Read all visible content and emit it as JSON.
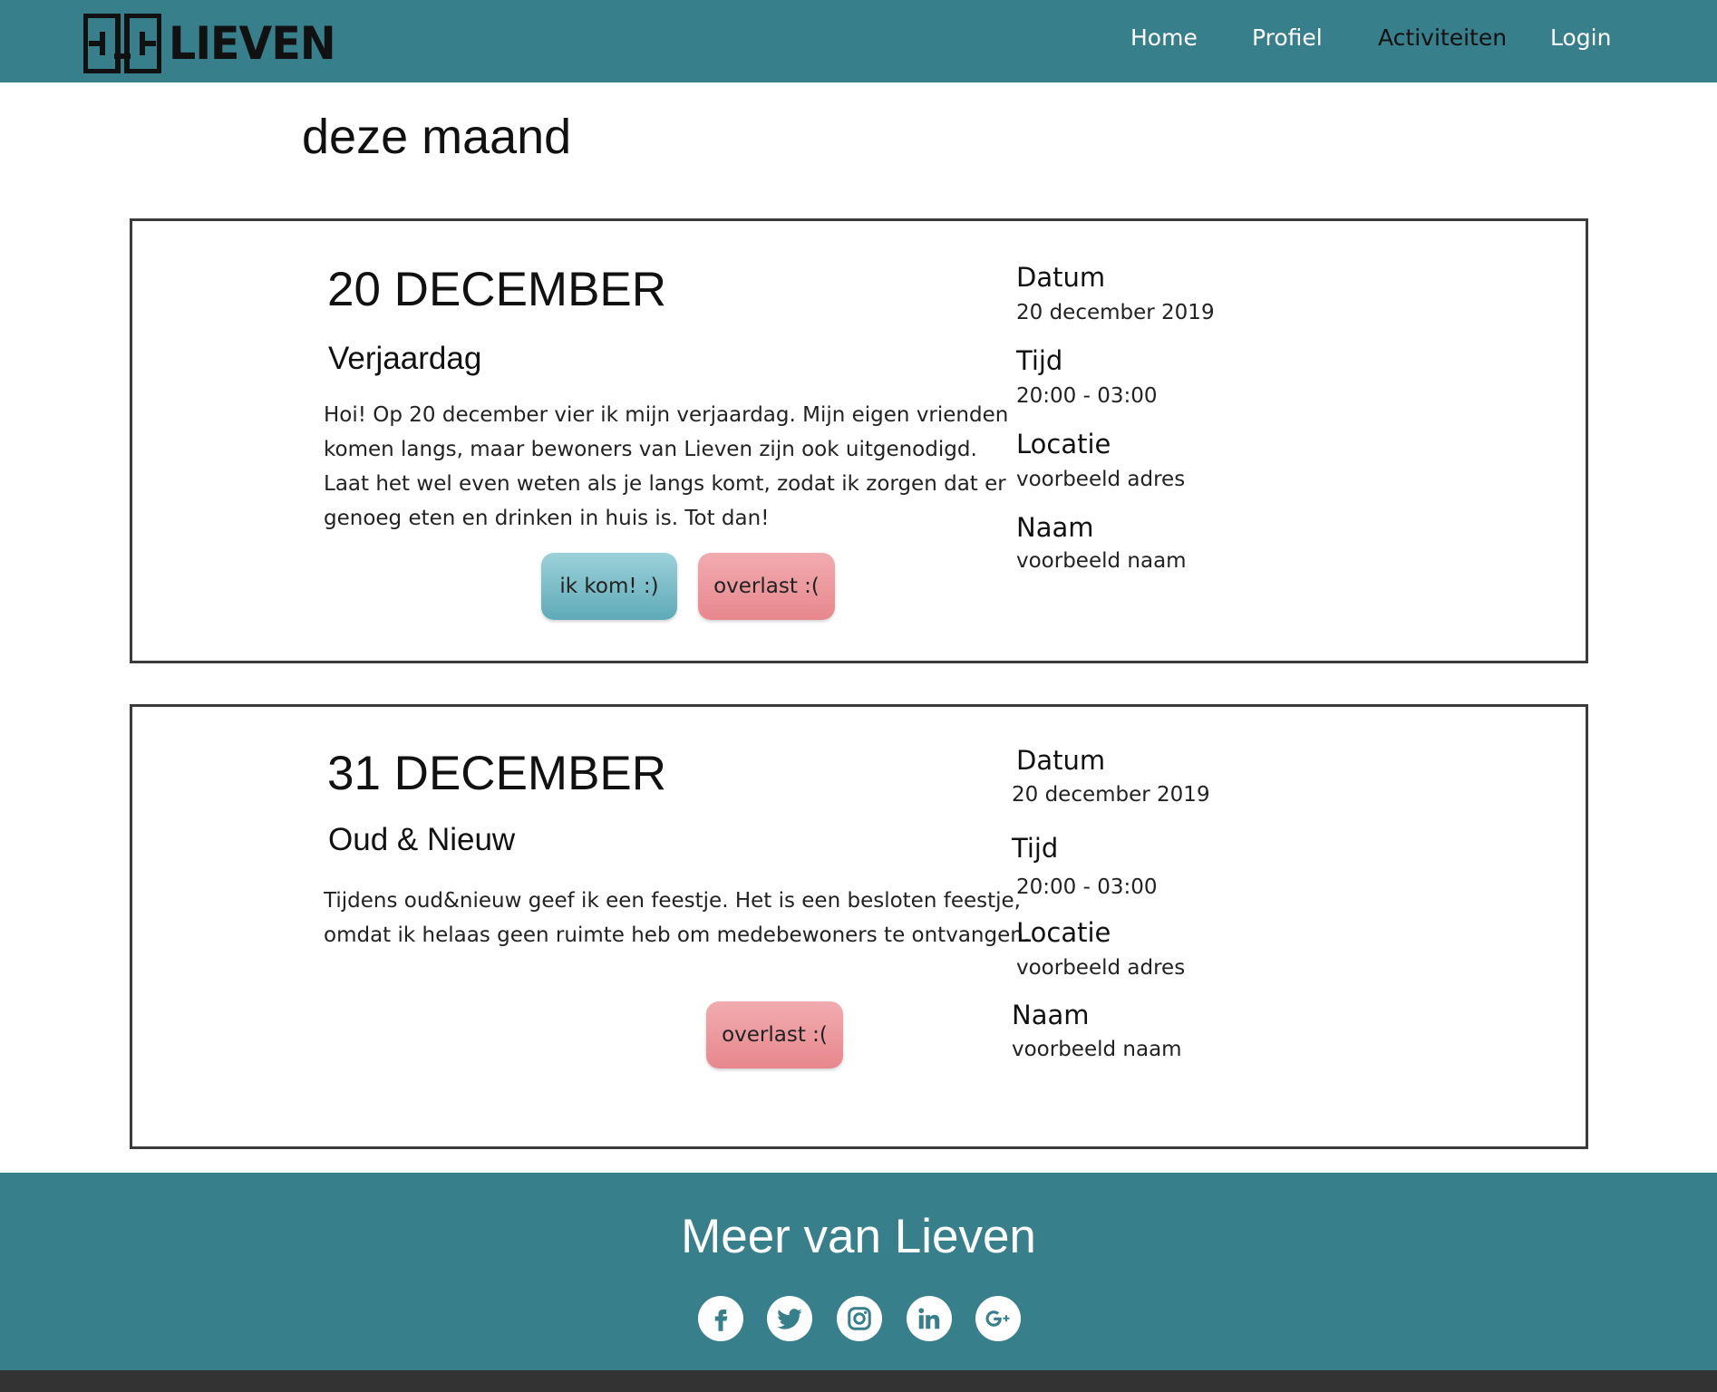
{
  "header": {
    "brand": "LIEVEN",
    "nav": [
      {
        "label": "Home",
        "active": false
      },
      {
        "label": "Profiel",
        "active": false
      },
      {
        "label": "Activiteiten",
        "active": true
      },
      {
        "label": "Login",
        "active": false
      }
    ]
  },
  "main": {
    "section_title": "deze maand",
    "events": [
      {
        "date_heading": "20 DECEMBER",
        "title": "Verjaardag",
        "description": "Hoi! Op 20 december vier ik mijn verjaardag. Mijn eigen vrienden komen langs, maar bewoners van Lieven zijn ook uitgenodigd. Laat het wel even weten als je langs komt, zodat ik zorgen dat er genoeg eten en drinken in huis is. Tot dan!",
        "buttons": {
          "come": "ik kom! :)",
          "overlast": "overlast :("
        },
        "info": {
          "datum_label": "Datum",
          "datum": "20 december 2019",
          "tijd_label": "Tijd",
          "tijd": "20:00 - 03:00",
          "locatie_label": "Locatie",
          "locatie": "voorbeeld adres",
          "naam_label": "Naam",
          "naam": "voorbeeld naam"
        }
      },
      {
        "date_heading": "31 DECEMBER",
        "title": "Oud & Nieuw",
        "description": "Tijdens oud&nieuw geef ik een feestje. Het is een besloten feestje, omdat ik helaas geen ruimte heb om medebewoners te ontvangen.",
        "buttons": {
          "overlast": "overlast :("
        },
        "info": {
          "datum_label": "Datum",
          "datum": "20 december 2019",
          "tijd_label": "Tijd",
          "tijd": "20:00 - 03:00",
          "locatie_label": "Locatie",
          "locatie": "voorbeeld adres",
          "naam_label": "Naam",
          "naam": "voorbeeld naam"
        }
      }
    ]
  },
  "footer": {
    "title": "Meer van Lieven",
    "social": [
      "facebook-icon",
      "twitter-icon",
      "instagram-icon",
      "linkedin-icon",
      "google-plus-icon"
    ]
  },
  "colors": {
    "primary": "#377f8b",
    "button_come": "#6cb5c1",
    "button_overlast": "#ec9499",
    "bottom_bar": "#333333"
  }
}
